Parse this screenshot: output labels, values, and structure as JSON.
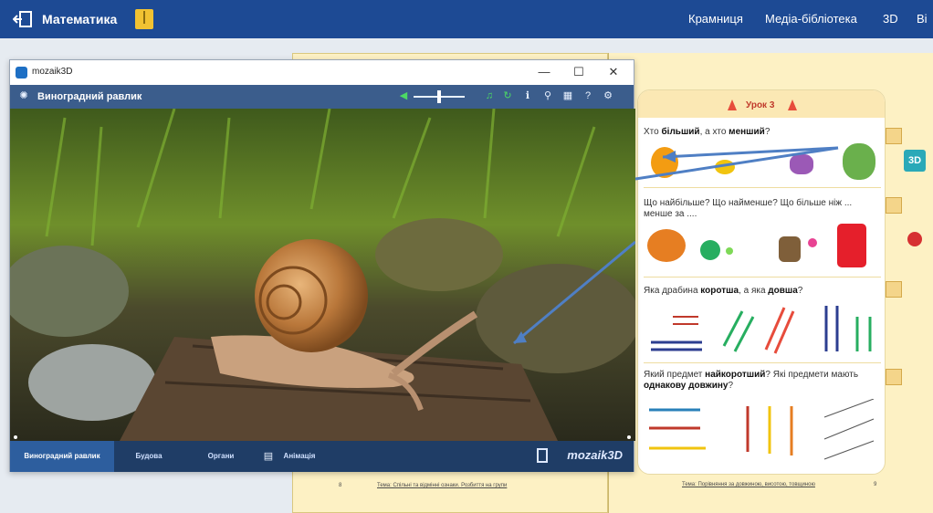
{
  "topbar": {
    "title": "Математика",
    "nav": [
      "Крамниця",
      "Медіа-бібліотека",
      "3D",
      "Ві"
    ]
  },
  "window": {
    "app_name": "mozaik3D",
    "controls": [
      "—",
      "☐",
      "✕"
    ],
    "scene_title": "Виноградний равлик",
    "tabs": [
      "Виноградний равлик",
      "Будова",
      "Органи",
      "Анімація"
    ],
    "brand": "mozaik3D"
  },
  "lesson": {
    "heading": "Урок 3",
    "q1_pre": "Хто ",
    "q1_b1": "більший",
    "q1_mid": ", а хто ",
    "q1_b2": "менший",
    "q1_post": "?",
    "q2": "Що найбільше? Що найменше? Що більше ніж ... менше за ....",
    "q3_pre": "Яка драбина ",
    "q3_b1": "коротша",
    "q3_mid": ", а яка ",
    "q3_b2": "довша",
    "q3_post": "?",
    "q4_pre": "Який предмет ",
    "q4_b1": "найкоротший",
    "q4_mid": "? Які предмети мають ",
    "q4_b2": "однакову довжину",
    "q4_post": "?",
    "btn_3d": "3D"
  },
  "pages": {
    "left_num": "8",
    "left_footer": "Тема: Спільні та відмінні ознаки. Розбиття на групи",
    "right_num": "9",
    "right_footer": "Тема: Порівняння за довжиною, висотою, товщиною"
  },
  "colors": {
    "topbar": "#1d4a94",
    "toolbar": "#3b5d8c",
    "tabs_bg": "#1f3d66",
    "accent_green": "#4cd964",
    "arrow": "#4f7fc4"
  }
}
